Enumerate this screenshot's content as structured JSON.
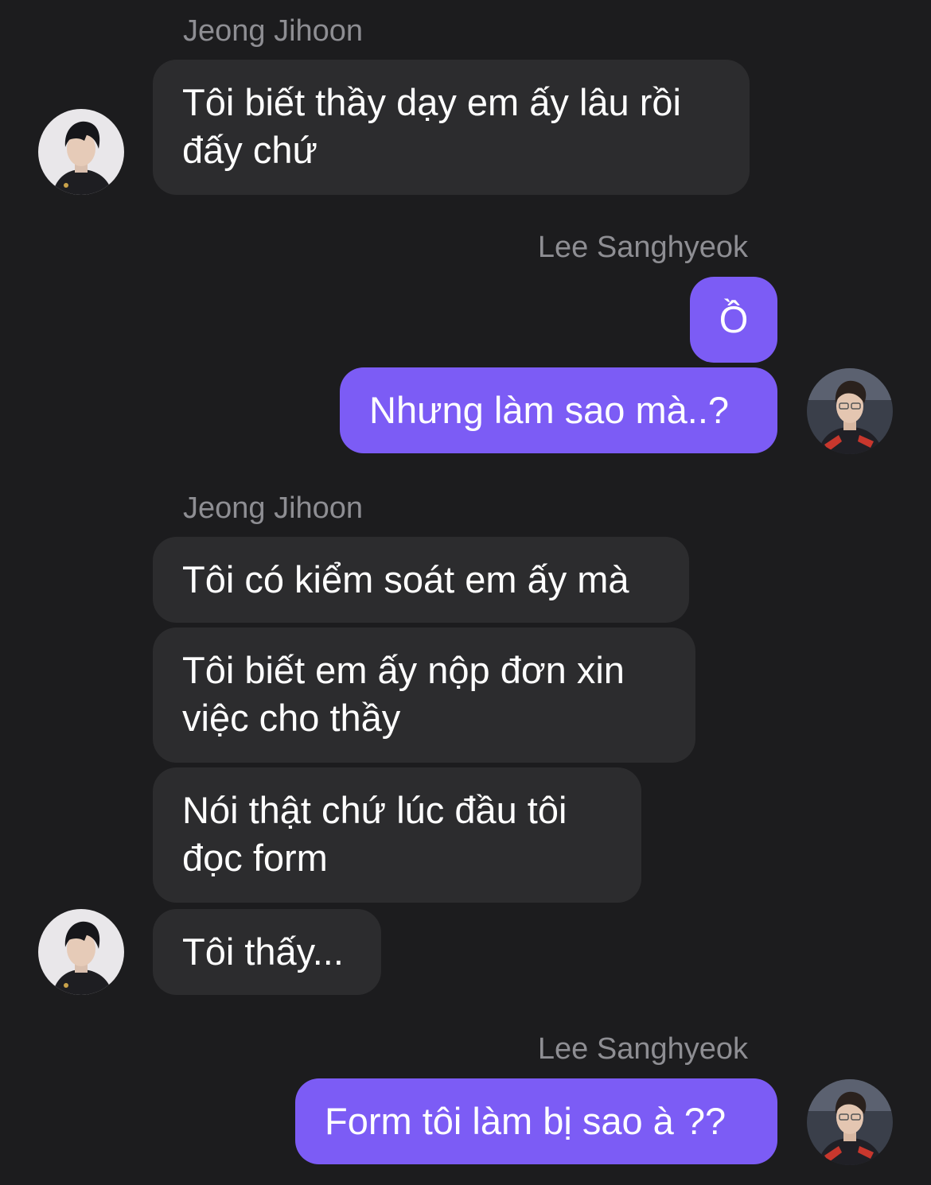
{
  "colors": {
    "background": "#1c1c1e",
    "incoming_bubble": "#2c2c2e",
    "outgoing_bubble": "#7c5cf5",
    "sender_name": "#8e8e93"
  },
  "messages": [
    {
      "sender": "Jeong Jihoon",
      "direction": "incoming",
      "bubbles": [
        "Tôi biết thầy dạy em ấy lâu rồi\nđấy chứ"
      ],
      "avatar": "avatar-jeong-jihoon"
    },
    {
      "sender": "Lee Sanghyeok",
      "direction": "outgoing",
      "bubbles": [
        "Ồ",
        "Nhưng làm sao mà..?"
      ],
      "avatar": "avatar-lee-sanghyeok"
    },
    {
      "sender": "Jeong Jihoon",
      "direction": "incoming",
      "bubbles": [
        "Tôi có kiểm soát em ấy mà",
        "Tôi biết em ấy nộp đơn xin\nviệc cho thầy",
        "Nói thật chứ lúc đầu tôi\nđọc form",
        "Tôi thấy..."
      ],
      "avatar": "avatar-jeong-jihoon"
    },
    {
      "sender": "Lee Sanghyeok",
      "direction": "outgoing",
      "bubbles": [
        "Form tôi làm bị sao à ??"
      ],
      "avatar": "avatar-lee-sanghyeok"
    }
  ]
}
